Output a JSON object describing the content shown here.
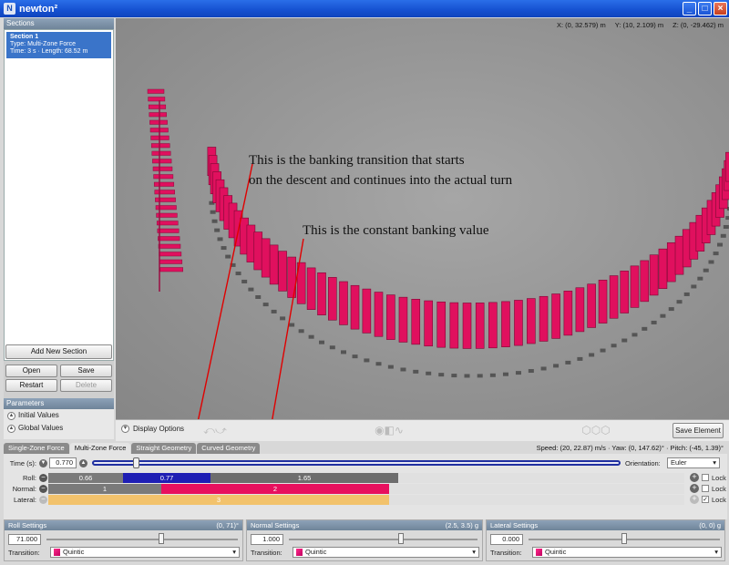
{
  "window": {
    "title": "newton²",
    "icon": "N",
    "minimize": "_",
    "maximize": "□",
    "close": "×"
  },
  "sidebar": {
    "sections_header": "Sections",
    "section": {
      "name": "Section 1",
      "type": "Type: Multi-Zone Force",
      "meta": "Time: 3 s · Length: 68.52 m"
    },
    "add_label": "Add New Section",
    "open_label": "Open",
    "save_label": "Save",
    "restart_label": "Restart",
    "delete_label": "Delete",
    "params_header": "Parameters",
    "initial_values": "Initial Values",
    "global_values": "Global Values"
  },
  "viewport": {
    "coord_x": "X: (0, 32.579) m",
    "coord_y": "Y: (10, 2.109) m",
    "coord_z": "Z: (0, -29.462) m",
    "annotation_1": "This is the banking transition that starts\non the descent and continues into the actual turn",
    "annotation_2": "This is the constant banking value",
    "track_color": "#e0105e"
  },
  "toolbar": {
    "display_options": "Display Options",
    "save_element": "Save Element"
  },
  "tabs": [
    "Single-Zone Force",
    "Multi-Zone Force",
    "Straight Geometry",
    "Curved Geometry"
  ],
  "status": {
    "speed": "Speed: (20, 22.87) m/s · Yaw: (0, 147.62)° · Pitch: (-45, 1.39)°"
  },
  "timeline": {
    "time_label": "Time (s):",
    "time_value": "0.770",
    "orientation_label": "Orientation:",
    "orientation_value": "Euler",
    "roll_label": "Roll:",
    "normal_label": "Normal:",
    "lateral_label": "Lateral:",
    "lock_label": "Lock",
    "roll_segments": [
      {
        "label": "0.66",
        "color": "#7a7a7a"
      },
      {
        "label": "0.77",
        "color": "#1e1eb4"
      },
      {
        "label": "1.65",
        "color": "#6d6d6d"
      }
    ],
    "normal_segments": [
      {
        "label": "1",
        "color": "#7a7a7a"
      },
      {
        "label": "2",
        "color": "#e8105e"
      }
    ],
    "lateral_segments": [
      {
        "label": "3",
        "color": "#f2c26c"
      }
    ]
  },
  "settings": {
    "roll": {
      "title": "Roll Settings",
      "range": "(0, 71)°",
      "value": "71.000",
      "transition_label": "Transition:",
      "transition": "Quintic"
    },
    "normal": {
      "title": "Normal Settings",
      "range": "(2.5, 3.5) g",
      "value": "1.000",
      "transition_label": "Transition:",
      "transition": "Quintic"
    },
    "lateral": {
      "title": "Lateral Settings",
      "range": "(0, 0) g",
      "value": "0.000",
      "transition_label": "Transition:",
      "transition": "Quintic"
    }
  }
}
